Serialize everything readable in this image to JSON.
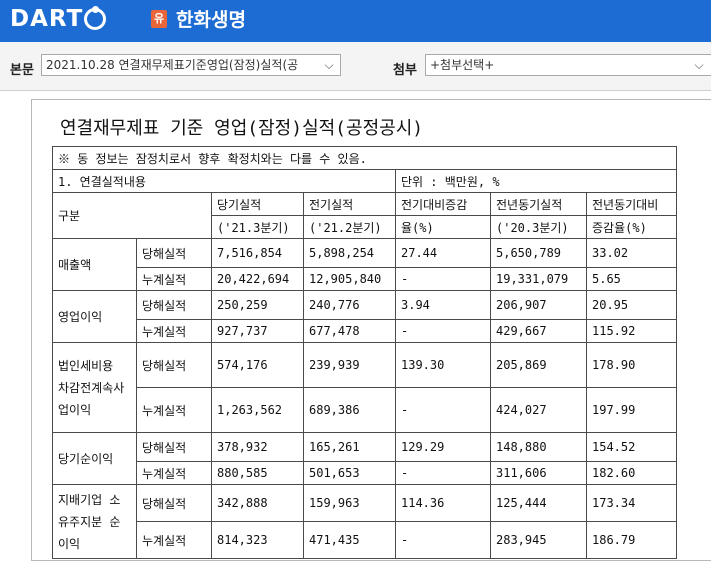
{
  "header": {
    "logo": "DART",
    "badge": "유",
    "company": "한화생명"
  },
  "toolbar": {
    "main_label": "본문",
    "main_select": "2021.10.28  연결재무제표기준영업(잠정)실적(공",
    "attach_label": "첨부",
    "attach_select": "+첨부선택+"
  },
  "document": {
    "title": "연결재무제표 기준 영업(잠정)실적(공정공시)",
    "notice": "※ 동 정보는 잠정치로서 향후 확정치와는 다를 수 있음.",
    "section": "1. 연결실적내용",
    "unit": "단위 : 백만원, %",
    "headers": {
      "gubun": "구분",
      "current": "당기실적",
      "current_period": "('21.3분기)",
      "previous": "전기실적",
      "previous_period": "('21.2분기)",
      "qoq_line1": "전기대비증감",
      "qoq_line2": "율(%)",
      "yoy_prev": "전년동기실적",
      "yoy_period": "('20.3분기)",
      "yoy_rate_line1": "전년동기대비",
      "yoy_rate_line2": "증감율(%)"
    },
    "groups": [
      {
        "label": "매출액",
        "rows": [
          {
            "type": "당해실적",
            "cur": "7,516,854",
            "prev": "5,898,254",
            "qoq": "27.44",
            "yoy": "5,650,789",
            "yoyr": "33.02"
          },
          {
            "type": "누계실적",
            "cur": "20,422,694",
            "prev": "12,905,840",
            "qoq": "-",
            "yoy": "19,331,079",
            "yoyr": "5.65"
          }
        ]
      },
      {
        "label": "영업이익",
        "rows": [
          {
            "type": "당해실적",
            "cur": "250,259",
            "prev": "240,776",
            "qoq": "3.94",
            "yoy": "206,907",
            "yoyr": "20.95"
          },
          {
            "type": "누계실적",
            "cur": "927,737",
            "prev": "677,478",
            "qoq": "-",
            "yoy": "429,667",
            "yoyr": "115.92"
          }
        ]
      },
      {
        "label": "법인세비용차감전계속사업이익",
        "label_lines": [
          "법인세비용",
          "차감전계속사",
          "업이익"
        ],
        "rows": [
          {
            "type": "당해실적",
            "cur": "574,176",
            "prev": "239,939",
            "qoq": "139.30",
            "yoy": "205,869",
            "yoyr": "178.90"
          },
          {
            "type": "누계실적",
            "cur": "1,263,562",
            "prev": "689,386",
            "qoq": "-",
            "yoy": "424,027",
            "yoyr": "197.99"
          }
        ]
      },
      {
        "label": "당기순이익",
        "rows": [
          {
            "type": "당해실적",
            "cur": "378,932",
            "prev": "165,261",
            "qoq": "129.29",
            "yoy": "148,880",
            "yoyr": "154.52"
          },
          {
            "type": "누계실적",
            "cur": "880,585",
            "prev": "501,653",
            "qoq": "-",
            "yoy": "311,606",
            "yoyr": "182.60"
          }
        ]
      },
      {
        "label": "지배기업 소유주지분 순이익",
        "label_lines": [
          "지배기업 소",
          "유주지분 순",
          "이익"
        ],
        "rows": [
          {
            "type": "당해실적",
            "cur": "342,888",
            "prev": "159,963",
            "qoq": "114.36",
            "yoy": "125,444",
            "yoyr": "173.34"
          },
          {
            "type": "누계실적",
            "cur": "814,323",
            "prev": "471,435",
            "qoq": "-",
            "yoy": "283,945",
            "yoyr": "186.79"
          }
        ]
      }
    ]
  }
}
